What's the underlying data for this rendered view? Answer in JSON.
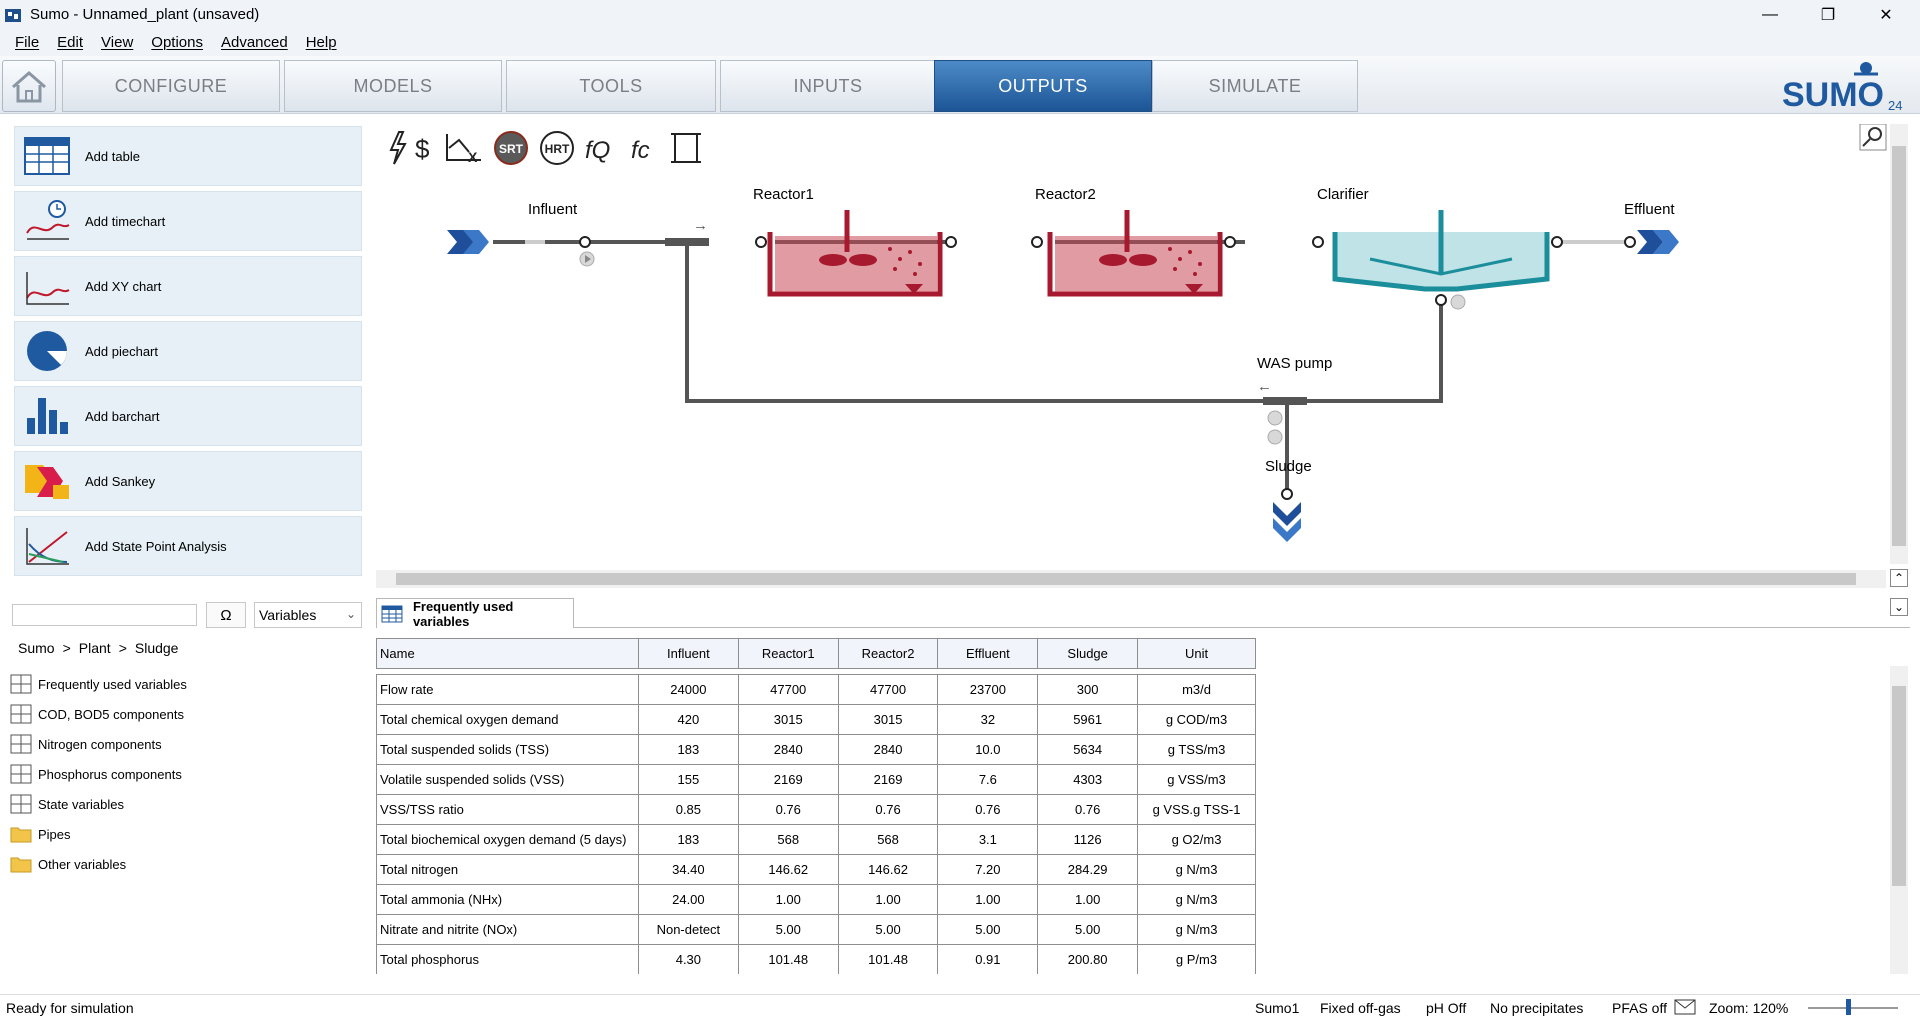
{
  "window": {
    "title": "Sumo - Unnamed_plant (unsaved)"
  },
  "menu": [
    "File",
    "Edit",
    "View",
    "Options",
    "Advanced",
    "Help"
  ],
  "tabs": [
    "CONFIGURE",
    "MODELS",
    "TOOLS",
    "INPUTS",
    "OUTPUTS",
    "SIMULATE"
  ],
  "active_tab": "OUTPUTS",
  "logo_text": "SUMO",
  "logo_sub": "24",
  "add_buttons": [
    "Add table",
    "Add timechart",
    "Add XY chart",
    "Add piechart",
    "Add barchart",
    "Add Sankey",
    "Add State Point Analysis"
  ],
  "toolbar_icons": [
    "lightning-icon",
    "dollar-icon",
    "chart-x-icon",
    "srt-icon",
    "hrt-icon",
    "fq-icon",
    "fc-icon",
    "scroll-icon"
  ],
  "toolbar_badges": {
    "srt": "SRT",
    "hrt": "HRT"
  },
  "diagram": {
    "labels": {
      "influent": "Influent",
      "reactor1": "Reactor1",
      "reactor2": "Reactor2",
      "clarifier": "Clarifier",
      "effluent": "Effluent",
      "was_pump": "WAS pump",
      "sludge": "Sludge"
    }
  },
  "search": {
    "value": "",
    "omega": "Ω",
    "select_value": "Variables"
  },
  "breadcrumb": [
    "Sumo",
    ">",
    "Plant",
    ">",
    "Sludge"
  ],
  "tree": [
    {
      "label": "Frequently used variables",
      "icon": "grid-icon"
    },
    {
      "label": "COD, BOD5 components",
      "icon": "grid-icon"
    },
    {
      "label": "Nitrogen components",
      "icon": "grid-icon"
    },
    {
      "label": "Phosphorus components",
      "icon": "grid-icon"
    },
    {
      "label": "State variables",
      "icon": "grid-icon"
    },
    {
      "label": "Pipes",
      "icon": "folder-icon"
    },
    {
      "label": "Other variables",
      "icon": "folder-icon"
    }
  ],
  "table_tab": "Frequently used variables",
  "table": {
    "headers": [
      "Name",
      "Influent",
      "Reactor1",
      "Reactor2",
      "Effluent",
      "Sludge",
      "Unit"
    ],
    "rows": [
      [
        "Flow rate",
        "24000",
        "47700",
        "47700",
        "23700",
        "300",
        "m3/d"
      ],
      [
        "Total chemical oxygen demand",
        "420",
        "3015",
        "3015",
        "32",
        "5961",
        "g COD/m3"
      ],
      [
        "Total suspended solids (TSS)",
        "183",
        "2840",
        "2840",
        "10.0",
        "5634",
        "g TSS/m3"
      ],
      [
        "Volatile suspended solids (VSS)",
        "155",
        "2169",
        "2169",
        "7.6",
        "4303",
        "g VSS/m3"
      ],
      [
        "VSS/TSS ratio",
        "0.85",
        "0.76",
        "0.76",
        "0.76",
        "0.76",
        "g VSS.g TSS-1"
      ],
      [
        "Total biochemical oxygen demand (5 days)",
        "183",
        "568",
        "568",
        "3.1",
        "1126",
        "g O2/m3"
      ],
      [
        "Total nitrogen",
        "34.40",
        "146.62",
        "146.62",
        "7.20",
        "284.29",
        "g N/m3"
      ],
      [
        "Total ammonia (NHx)",
        "24.00",
        "1.00",
        "1.00",
        "1.00",
        "1.00",
        "g N/m3"
      ],
      [
        "Nitrate and nitrite (NOx)",
        "Non-detect",
        "5.00",
        "5.00",
        "5.00",
        "5.00",
        "g N/m3"
      ],
      [
        "Total phosphorus",
        "4.30",
        "101.48",
        "101.48",
        "0.91",
        "200.80",
        "g P/m3"
      ]
    ]
  },
  "status": {
    "left": "Ready for simulation",
    "model": "Sumo1",
    "offgas": "Fixed off-gas",
    "ph": "pH Off",
    "precip": "No precipitates",
    "pfas": "PFAS off",
    "zoom": "Zoom: 120%"
  },
  "colors": {
    "accent": "#1f5aa0",
    "reactor": "#a6192e",
    "clarifier": "#1b8e9b"
  }
}
